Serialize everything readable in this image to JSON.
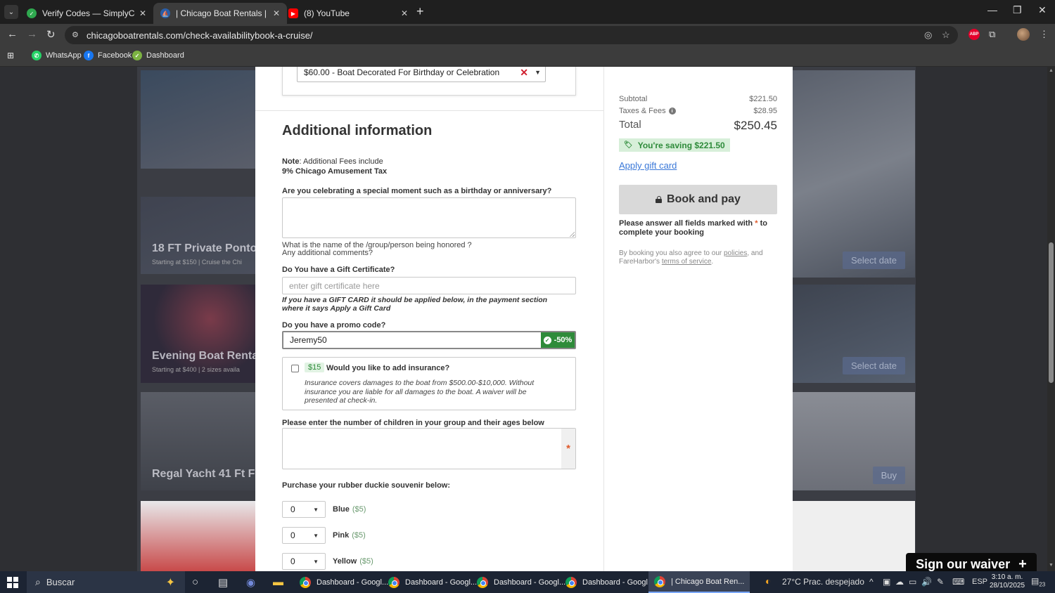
{
  "browser": {
    "tabs": [
      {
        "title": "Verify Codes — SimplyCodes",
        "active": false
      },
      {
        "title": "| Chicago Boat Rentals | Rent a",
        "active": true
      },
      {
        "title": "(8) YouTube",
        "active": false
      }
    ],
    "url": "chicagoboatrentals.com/check-availabilitybook-a-cruise/",
    "abp_label": "ABP",
    "bookmarks": [
      {
        "label": "WhatsApp",
        "icon": "whatsapp-icon"
      },
      {
        "label": "Facebook",
        "icon": "facebook-icon"
      },
      {
        "label": "Dashboard",
        "icon": "dashboard-icon"
      }
    ]
  },
  "background_cards": [
    {
      "title": "18 FT Private Ponto",
      "subtitle": "Starting at $150 | Cruise the Chi",
      "button": "Select date"
    },
    {
      "title": "Evening Boat Rental",
      "subtitle": "Starting at $400 | 2 sizes availa",
      "button": "Select date"
    },
    {
      "title": "Regal Yacht 41 Ft Fl",
      "subtitle": "",
      "button": "Buy"
    }
  ],
  "form": {
    "upgrade_selected": "$60.00 - Boat Decorated For Birthday or Celebration",
    "section_title": "Additional information",
    "note_label": "Note",
    "note_text": ": Additional Fees include",
    "note_tax": "9% Chicago Amusement Tax",
    "celebration_question": "Are you celebrating a special moment such as a birthday or anniversary?",
    "celebration_value": "",
    "celebration_help_1": "What is the name of the /group/person being honored ?",
    "celebration_help_2": "Any additional comments?",
    "gift_cert_label": "Do You have a Gift Certificate?",
    "gift_cert_placeholder": "enter gift certificate here",
    "gift_card_note": "If you have a GIFT CARD it should be applied below, in the payment section where it says Apply a Gift Card",
    "promo_label": "Do you have a promo code?",
    "promo_value": "Jeremy50",
    "promo_badge": "-50%",
    "insurance_price": "$15",
    "insurance_question": "Would you like to add insurance?",
    "insurance_desc": "Insurance covers damages to the boat from $500.00-$10,000. Without insurance you are liable for all damages to the boat. A waiver will be presented at check-in.",
    "insurance_checked": false,
    "children_label": "Please enter the number of children in your group and their ages below",
    "children_value": "",
    "required_mark": "*",
    "duckie_label": "Purchase your rubber duckie souvenir below:",
    "duckies": [
      {
        "qty": "0",
        "color": "Blue",
        "price": "($5)"
      },
      {
        "qty": "0",
        "color": "Pink",
        "price": "($5)"
      },
      {
        "qty": "0",
        "color": "Yellow",
        "price": "($5)"
      }
    ]
  },
  "summary": {
    "subtotal_label": "Subtotal",
    "subtotal": "$221.50",
    "taxes_label": "Taxes & Fees",
    "taxes": "$28.95",
    "total_label": "Total",
    "total": "$250.45",
    "saving": "You're saving $221.50",
    "apply_gift_card": "Apply gift card",
    "book_button": "Book and pay",
    "warning_pre": "Please answer all fields marked with",
    "warning_star": "*",
    "warning_post": "to complete your booking",
    "terms_1": "By booking you also agree to our",
    "terms_policies": "policies",
    "terms_2": ", and FareHarbor's",
    "terms_tos": "terms of service",
    "terms_3": "."
  },
  "waiver_button": "Sign our waiver",
  "taskbar": {
    "search_placeholder": "Buscar",
    "apps": [
      {
        "label": "Dashboard - Googl...",
        "active": false
      },
      {
        "label": "Dashboard - Googl...",
        "active": false
      },
      {
        "label": "Dashboard - Googl...",
        "active": false
      },
      {
        "label": "Dashboard - Googl...",
        "active": false
      },
      {
        "label": "| Chicago Boat Ren...",
        "active": true
      }
    ],
    "weather": "27°C  Prac. despejado",
    "language": "ESP",
    "time": "3:10 a. m.",
    "date": "28/10/2025",
    "notifications": "23"
  },
  "colors": {
    "promo_green": "#2e8b3a",
    "link_blue": "#3a78d8",
    "required_orange": "#e05a2b"
  }
}
